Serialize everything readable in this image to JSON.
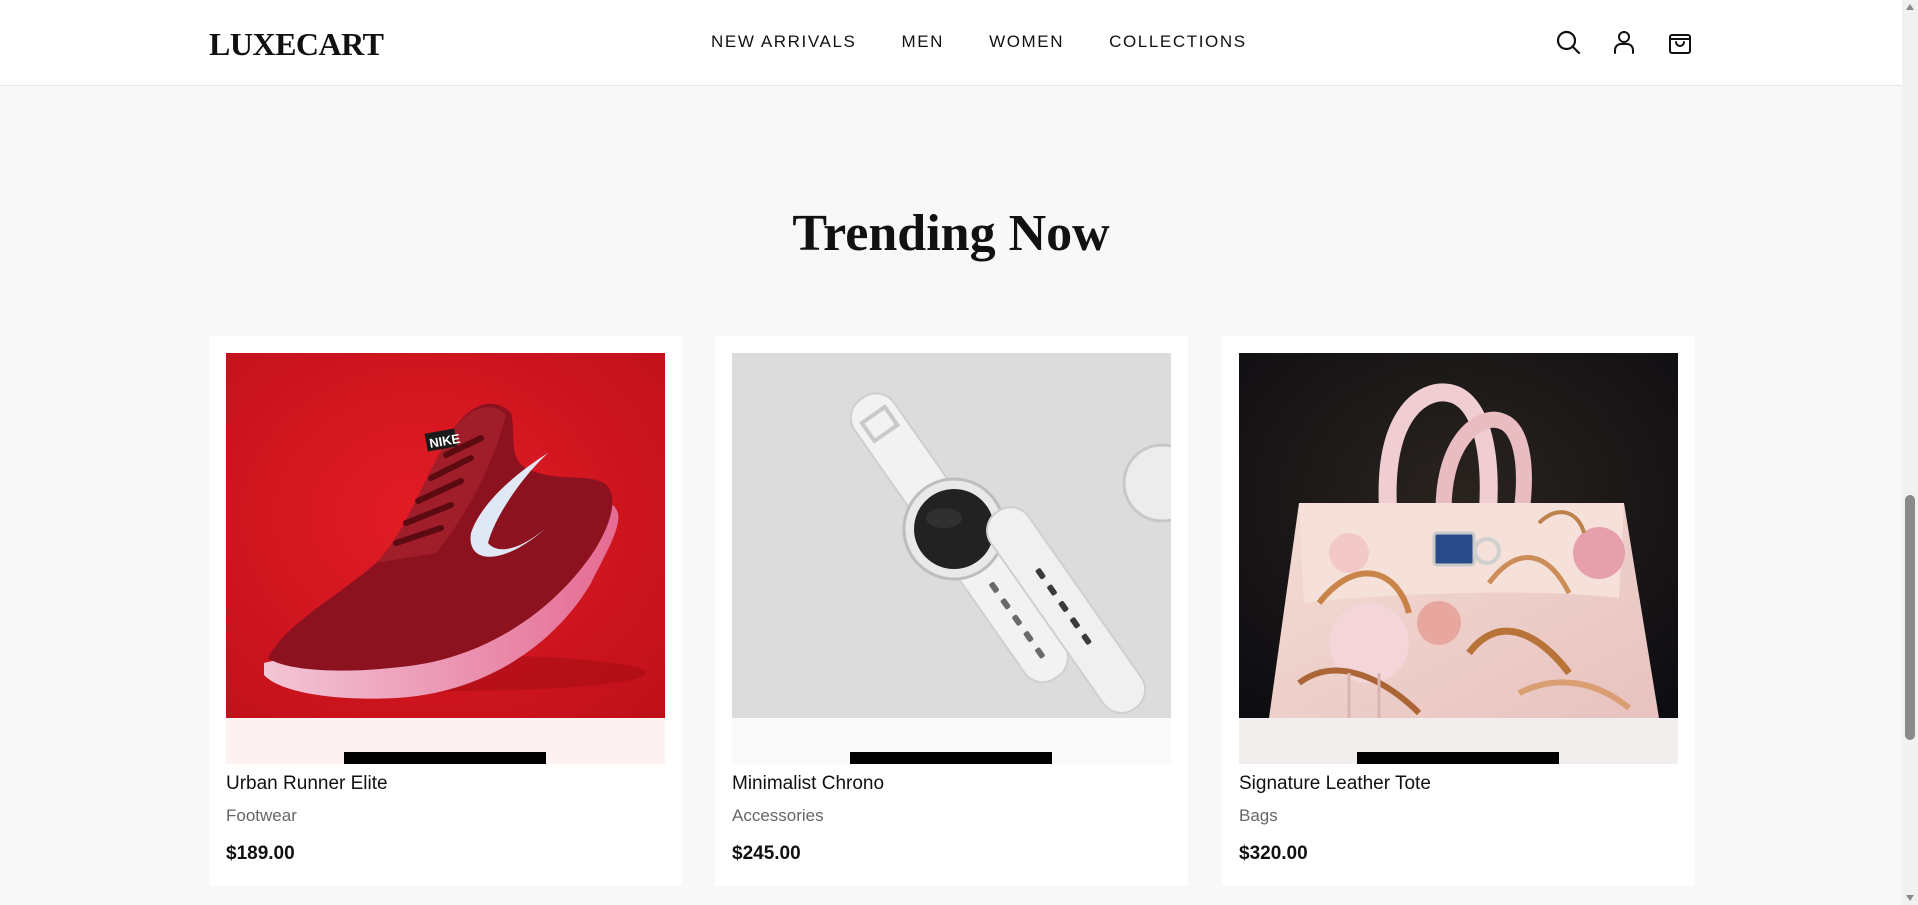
{
  "header": {
    "logo": "LUXECART",
    "nav": [
      "NEW ARRIVALS",
      "MEN",
      "WOMEN",
      "COLLECTIONS"
    ],
    "icons": [
      "search-icon",
      "user-icon",
      "shopping-bag-icon"
    ]
  },
  "section": {
    "title": "Trending Now"
  },
  "products": [
    {
      "name": "Urban Runner Elite",
      "category": "Footwear",
      "price": "$189.00",
      "image": "red-sneaker"
    },
    {
      "name": "Minimalist Chrono",
      "category": "Accessories",
      "price": "$245.00",
      "image": "white-smartwatch"
    },
    {
      "name": "Signature Leather Tote",
      "category": "Bags",
      "price": "$320.00",
      "image": "floral-handbag"
    }
  ],
  "colors": {
    "background": "#f8f8f8",
    "header": "#ffffff",
    "text": "#111111",
    "muted": "#666666",
    "button": "#000000"
  }
}
